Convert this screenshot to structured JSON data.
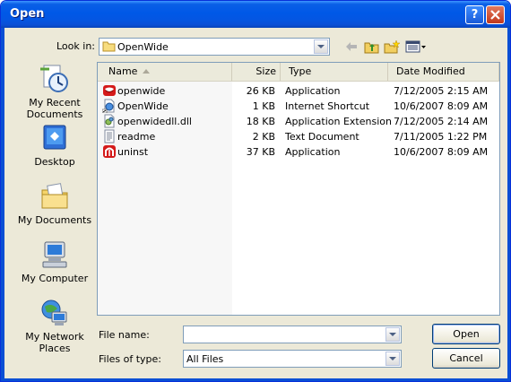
{
  "window": {
    "title": "Open"
  },
  "look_in": {
    "label": "Look in:",
    "value": "OpenWide"
  },
  "places": [
    {
      "label_lines": [
        "My Recent",
        "Documents"
      ],
      "icon": "recent-documents-icon"
    },
    {
      "label_lines": [
        "Desktop"
      ],
      "icon": "desktop-icon"
    },
    {
      "label_lines": [
        "My Documents"
      ],
      "icon": "my-documents-icon"
    },
    {
      "label_lines": [
        "My Computer"
      ],
      "icon": "my-computer-icon"
    },
    {
      "label_lines": [
        "My Network",
        "Places"
      ],
      "icon": "network-places-icon"
    }
  ],
  "columns": {
    "name": "Name",
    "size": "Size",
    "type": "Type",
    "date": "Date Modified"
  },
  "files": [
    {
      "name": "openwide",
      "size": "26 KB",
      "type": "Application",
      "date": "7/12/2005 2:15 AM",
      "icon": "app-mouth-icon"
    },
    {
      "name": "OpenWide",
      "size": "1 KB",
      "type": "Internet Shortcut",
      "date": "10/6/2007 8:09 AM",
      "icon": "internet-shortcut-icon"
    },
    {
      "name": "openwidedll.dll",
      "size": "18 KB",
      "type": "Application Extension",
      "date": "7/12/2005 2:14 AM",
      "icon": "dll-icon"
    },
    {
      "name": "readme",
      "size": "2 KB",
      "type": "Text Document",
      "date": "7/11/2005 1:22 PM",
      "icon": "text-document-icon"
    },
    {
      "name": "uninst",
      "size": "37 KB",
      "type": "Application",
      "date": "10/6/2007 8:09 AM",
      "icon": "uninstall-icon"
    }
  ],
  "file_name": {
    "label": "File name:",
    "value": ""
  },
  "file_type": {
    "label": "Files of type:",
    "value": "All Files"
  },
  "buttons": {
    "open": "Open",
    "cancel": "Cancel"
  },
  "colors": {
    "titlebar": "#0058e7",
    "dialog": "#ece9d8",
    "border": "#7f9db9"
  }
}
